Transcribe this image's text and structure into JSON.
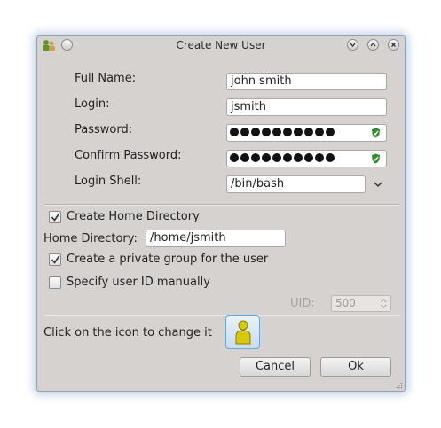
{
  "window": {
    "title": "Create New User",
    "accent_color": "#6fa6d6"
  },
  "form": {
    "full_name_label": "Full Name:",
    "full_name_value": "john smith",
    "login_label": "Login:",
    "login_value": "jsmith",
    "password_label": "Password:",
    "password_dot_count": 10,
    "confirm_password_label": "Confirm Password:",
    "confirm_dot_count": 10,
    "login_shell_label": "Login Shell:",
    "login_shell_value": "/bin/bash"
  },
  "options": {
    "create_home_label": "Create Home Directory",
    "create_home_checked": true,
    "home_dir_label": "Home Directory:",
    "home_dir_value": "/home/jsmith",
    "private_group_label": "Create a private group for the user",
    "private_group_checked": true,
    "specify_uid_label": "Specify user ID manually",
    "specify_uid_checked": false,
    "uid_label": "UID:",
    "uid_value": "500"
  },
  "icon_section": {
    "label": "Click on the icon to change it",
    "icon": "user-avatar-icon"
  },
  "buttons": {
    "cancel": "Cancel",
    "ok": "Ok"
  }
}
